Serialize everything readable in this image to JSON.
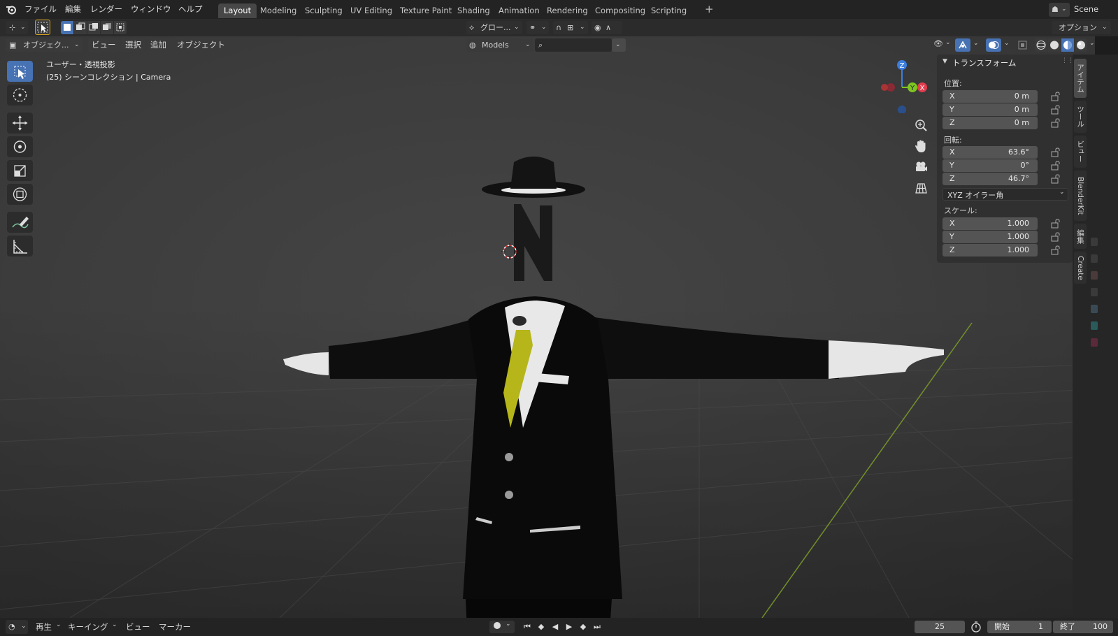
{
  "top_menu": {
    "items": [
      "ファイル",
      "編集",
      "レンダー",
      "ウィンドウ",
      "ヘルプ"
    ],
    "workspaces": [
      "Layout",
      "Modeling",
      "Sculpting",
      "UV Editing",
      "Texture Paint",
      "Shading",
      "Animation",
      "Rendering",
      "Compositing",
      "Scripting"
    ],
    "active_workspace": "Layout",
    "scene_label": "Scene"
  },
  "header": {
    "transform_orientation": "グロー...",
    "options_label": "オプション",
    "mode_label": "オブジェク...",
    "menus": [
      "ビュー",
      "選択",
      "追加",
      "オブジェクト"
    ],
    "collection_filter": "Models",
    "search_placeholder": ""
  },
  "viewport": {
    "view_name": "ユーザー・透視投影",
    "context": "(25) シーンコレクション | Camera",
    "gizmo_axes": {
      "x": "X",
      "y": "Y",
      "z": "Z"
    },
    "colors": {
      "x_axis": "#e23d4f",
      "y_axis": "#7ec61f",
      "z_axis": "#3c7ee0",
      "active": "#4772b3"
    }
  },
  "npanel": {
    "title": "トランスフォーム",
    "location_label": "位置:",
    "location": [
      {
        "axis": "X",
        "value": "0 m"
      },
      {
        "axis": "Y",
        "value": "0 m"
      },
      {
        "axis": "Z",
        "value": "0 m"
      }
    ],
    "rotation_label": "回転:",
    "rotation": [
      {
        "axis": "X",
        "value": "63.6°"
      },
      {
        "axis": "Y",
        "value": "0°"
      },
      {
        "axis": "Z",
        "value": "46.7°"
      }
    ],
    "rotation_mode": "XYZ オイラー角",
    "scale_label": "スケール:",
    "scale": [
      {
        "axis": "X",
        "value": "1.000"
      },
      {
        "axis": "Y",
        "value": "1.000"
      },
      {
        "axis": "Z",
        "value": "1.000"
      }
    ]
  },
  "side_tabs": [
    "アイテム",
    "ツール",
    "ビュー",
    "BlenderKit",
    "編集",
    "Create"
  ],
  "timeline": {
    "menus": [
      "再生",
      "キーイング",
      "ビュー",
      "マーカー"
    ],
    "current_frame": "25",
    "start_label": "開始",
    "start_value": "1",
    "end_label": "終了",
    "end_value": "100"
  }
}
